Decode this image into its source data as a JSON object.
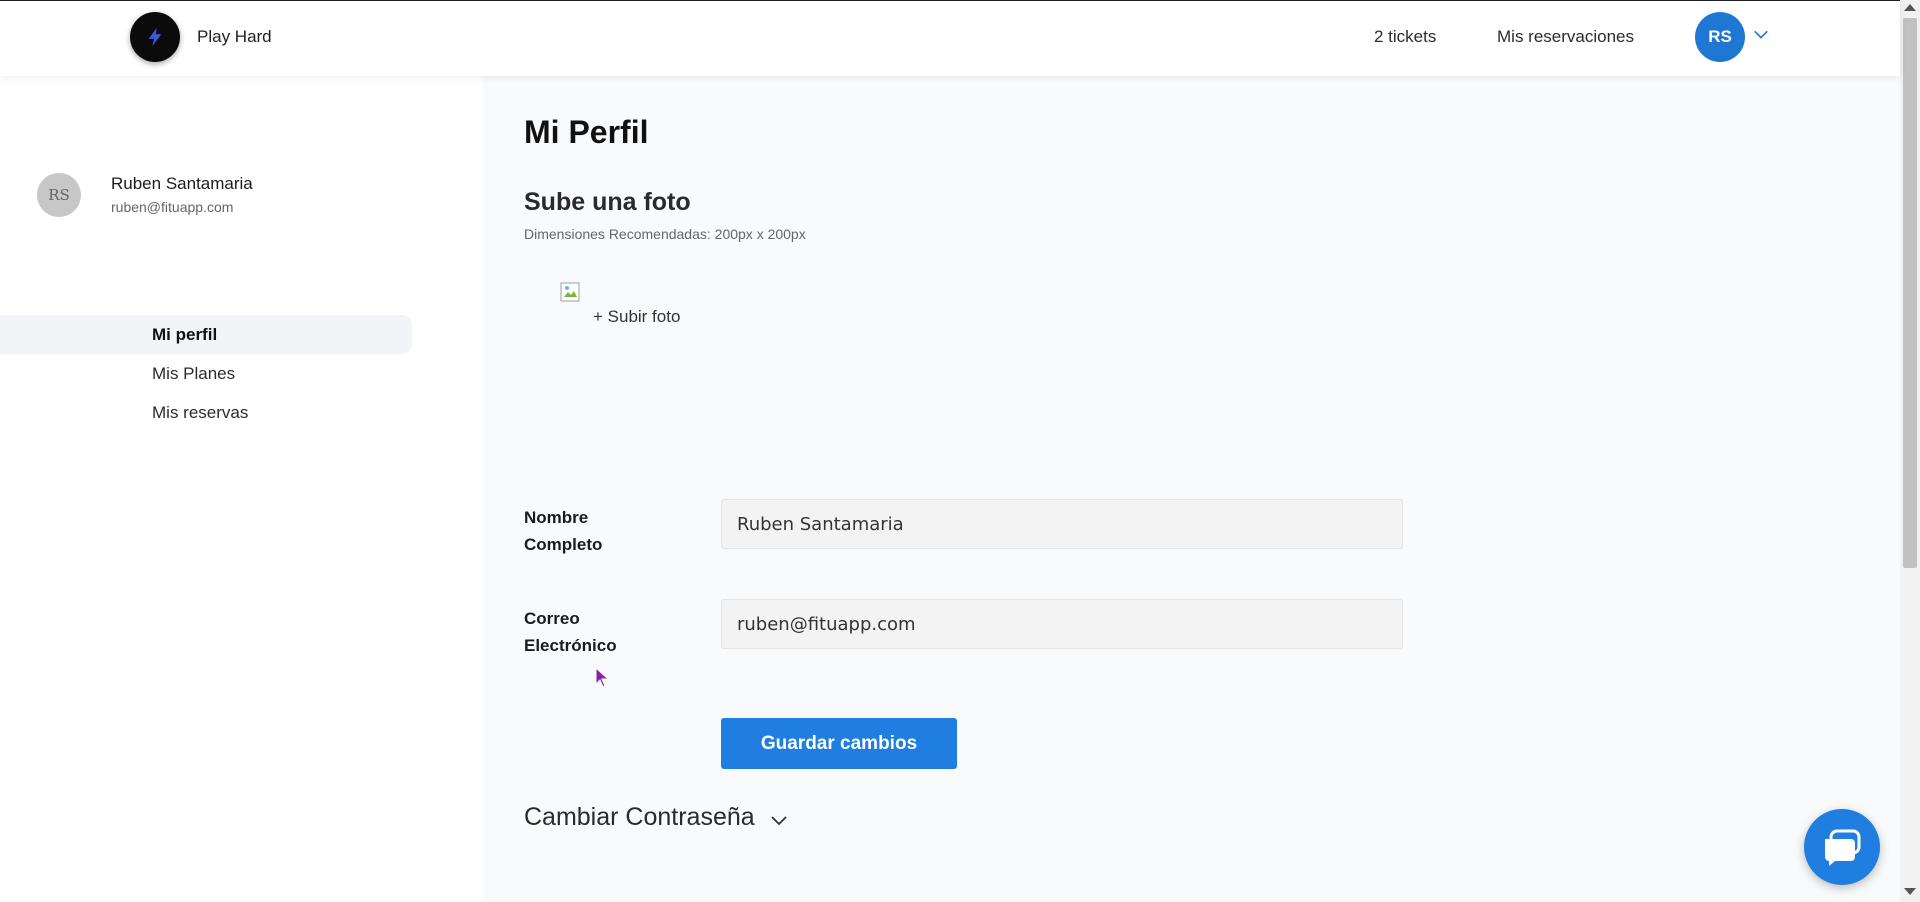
{
  "header": {
    "brand_name": "Play Hard",
    "tickets": "2 tickets",
    "reservations_link": "Mis reservaciones",
    "avatar_initials": "RS"
  },
  "sidebar": {
    "avatar_initials": "RS",
    "user_name": "Ruben Santamaria",
    "user_email": "ruben@fituapp.com",
    "items": [
      {
        "label": "Mi perfil",
        "active": true
      },
      {
        "label": "Mis Planes",
        "active": false
      },
      {
        "label": "Mis reservas",
        "active": false
      }
    ]
  },
  "main": {
    "title": "Mi Perfil",
    "photo_section_title": "Sube una foto",
    "photo_note": "Dimensiones Recomendadas: 200px x 200px",
    "upload_link": "+ Subir foto",
    "fields": {
      "name_label_line1": "Nombre",
      "name_label_line2": "Completo",
      "name_value": "Ruben Santamaria",
      "email_label_line1": "Correo",
      "email_label_line2": "Electrónico",
      "email_value": "ruben@fituapp.com"
    },
    "save_button": "Guardar cambios",
    "password_section": "Cambiar Contraseña"
  },
  "colors": {
    "primary": "#1f7ee0",
    "avatar_top": "#1f77d4",
    "logo_bolt": "#3a5bd9"
  },
  "icons": {
    "brand": "lightning-bolt-icon",
    "caret": "chevron-down-icon",
    "chat": "chat-bubble-icon"
  }
}
